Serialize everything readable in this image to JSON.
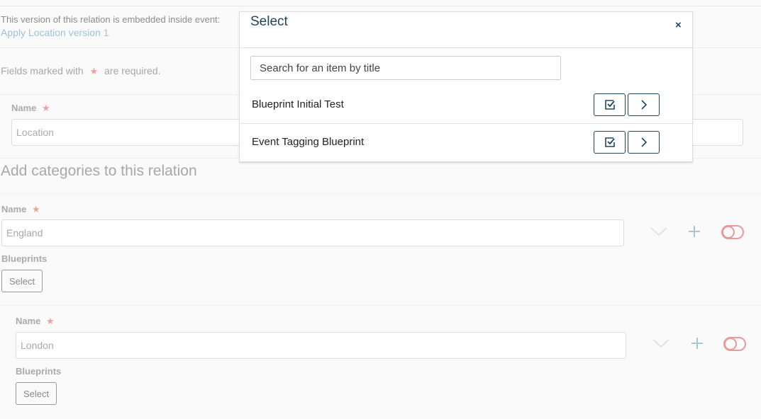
{
  "embed": {
    "note": "This version of this relation is embedded inside event:",
    "link": "Apply Location version 1"
  },
  "required": {
    "prefix": "Fields marked with",
    "suffix": "are required.",
    "star": "★"
  },
  "relation": {
    "name_label": "Name",
    "name_value": "Location"
  },
  "categories": {
    "title": "Add categories to this relation",
    "items": [
      {
        "name_label": "Name",
        "name_value": "England",
        "blueprints_label": "Blueprints",
        "select_label": "Select"
      },
      {
        "name_label": "Name",
        "name_value": "London",
        "blueprints_label": "Blueprints",
        "select_label": "Select"
      }
    ]
  },
  "modal": {
    "title": "Select",
    "close": "×",
    "search_placeholder": "Search for an item by title",
    "items": [
      {
        "title": "Blueprint Initial Test"
      },
      {
        "title": "Event Tagging Blueprint"
      }
    ]
  },
  "colors": {
    "accent": "#1f4560",
    "link": "#9fc3d4",
    "required_star": "#f0a0a0",
    "toggle": "#e89a9a"
  },
  "icons": [
    "chevron-down-icon",
    "plus-icon",
    "toggle-icon",
    "check-square-icon",
    "chevron-right-icon",
    "close-icon"
  ]
}
